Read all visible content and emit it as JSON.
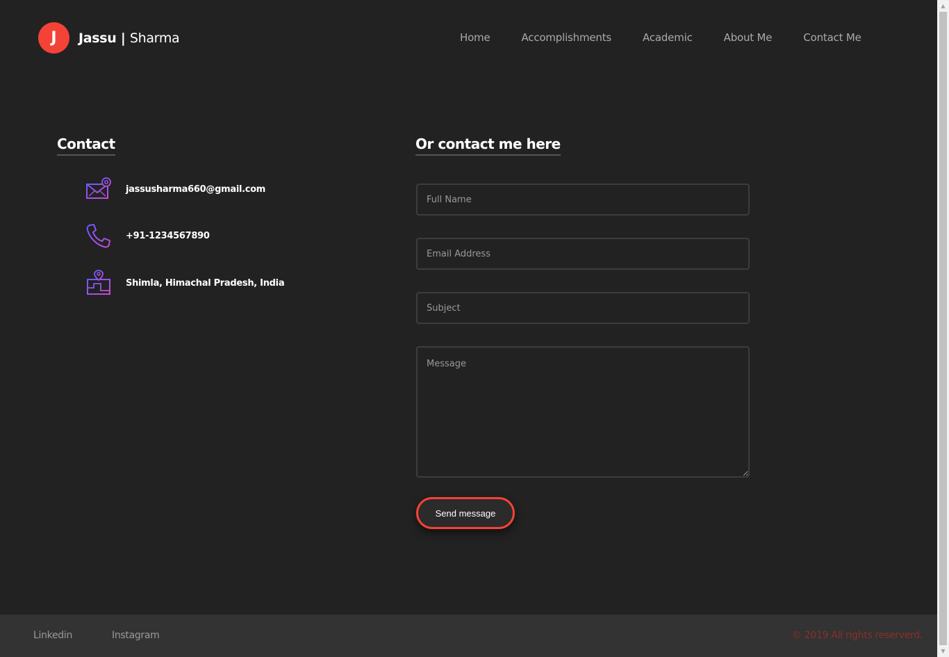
{
  "brand": {
    "initial": "J",
    "first": "Jassu",
    "separator": " | ",
    "last": "Sharma",
    "badge_color": "#f44336"
  },
  "nav": {
    "items": [
      {
        "label": "Home"
      },
      {
        "label": "Accomplishments"
      },
      {
        "label": "Academic"
      },
      {
        "label": "About Me"
      },
      {
        "label": "Contact Me"
      }
    ]
  },
  "contact": {
    "heading": "Contact",
    "email": {
      "icon": "envelope-icon",
      "text": "jassusharma660@gmail.com"
    },
    "phone": {
      "icon": "phone-icon",
      "text": "+91-1234567890"
    },
    "location": {
      "icon": "map-pin-icon",
      "text": "Shimla, Himachal Pradesh, India"
    }
  },
  "form": {
    "heading": "Or contact me here",
    "full_name_placeholder": "Full Name",
    "email_placeholder": "Email Address",
    "subject_placeholder": "Subject",
    "message_placeholder": "Message",
    "send_label": "Send message",
    "accent_color": "#f44336"
  },
  "footer": {
    "links": [
      {
        "label": "Linkedin"
      },
      {
        "label": "Instagram"
      }
    ],
    "copyright": "© 2019  All rights reserverd."
  }
}
